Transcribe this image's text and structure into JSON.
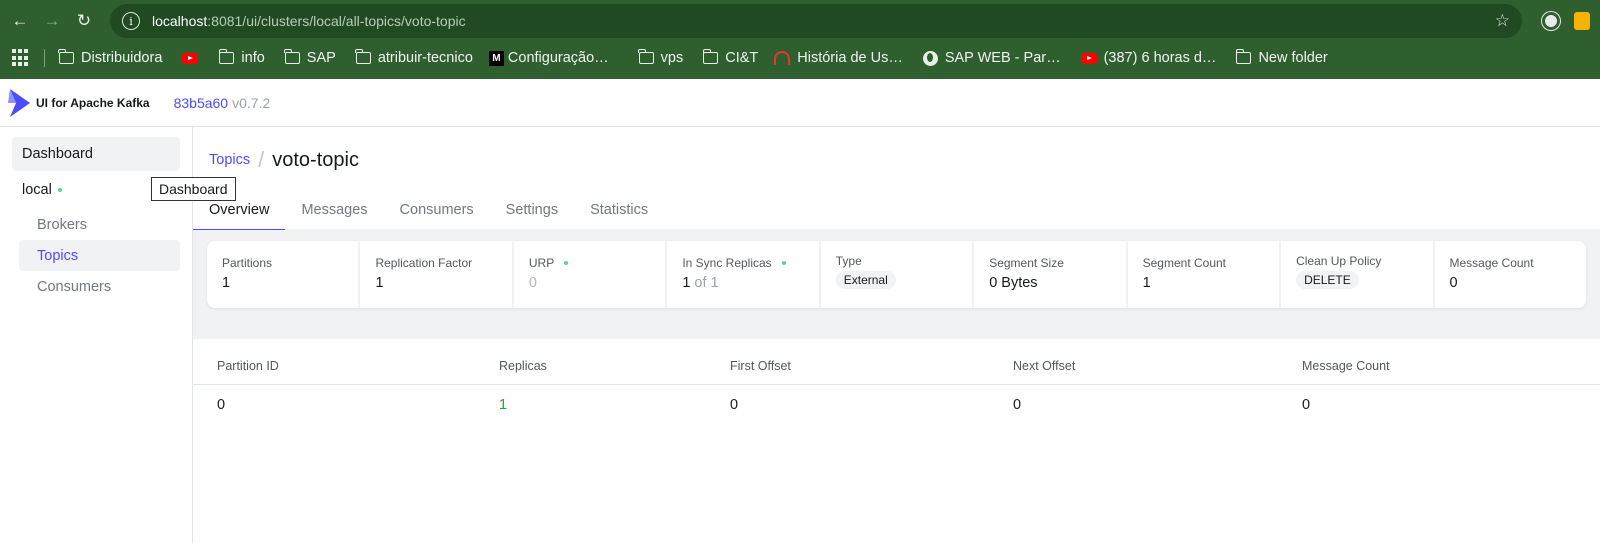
{
  "browser": {
    "url_host": "localhost",
    "url_rest": ":8081/ui/clusters/local/all-topics/voto-topic",
    "bookmarks": [
      {
        "label": "Distribuidora",
        "icon": "folder-icon"
      },
      {
        "label": "",
        "icon": "youtube-icon"
      },
      {
        "label": "info",
        "icon": "folder-icon"
      },
      {
        "label": "SAP",
        "icon": "folder-icon"
      },
      {
        "label": "atribuir-tecnico",
        "icon": "folder-icon"
      },
      {
        "label": "Configuração…",
        "icon": "medium-icon"
      },
      {
        "label": "vps",
        "icon": "folder-icon"
      },
      {
        "label": "CI&T",
        "icon": "folder-icon"
      },
      {
        "label": "História de Us…",
        "icon": "headset-icon"
      },
      {
        "label": "SAP WEB - Par…",
        "icon": "globe-icon"
      },
      {
        "label": "(387) 6 horas d…",
        "icon": "youtube-icon"
      },
      {
        "label": "New folder",
        "icon": "folder-icon"
      }
    ]
  },
  "header": {
    "brand": "UI for Apache Kafka",
    "commit": "83b5a60",
    "version": "v0.7.2"
  },
  "sidebar": {
    "dashboard": "Dashboard",
    "cluster": "local",
    "items": [
      "Brokers",
      "Topics",
      "Consumers"
    ],
    "tooltip": "Dashboard"
  },
  "breadcrumb": {
    "parent": "Topics",
    "separator": "/",
    "current": "voto-topic"
  },
  "tabs": [
    "Overview",
    "Messages",
    "Consumers",
    "Settings",
    "Statistics"
  ],
  "metrics": {
    "partitions": {
      "label": "Partitions",
      "value": "1"
    },
    "replication": {
      "label": "Replication Factor",
      "value": "1"
    },
    "urp": {
      "label": "URP",
      "value": "0"
    },
    "isr": {
      "label": "In Sync Replicas",
      "value": "1",
      "of": "of 1"
    },
    "type": {
      "label": "Type",
      "value": "External"
    },
    "segment_size": {
      "label": "Segment Size",
      "value": "0 Bytes"
    },
    "segment_count": {
      "label": "Segment Count",
      "value": "1"
    },
    "cleanup": {
      "label": "Clean Up Policy",
      "value": "DELETE"
    },
    "message_count": {
      "label": "Message Count",
      "value": "0"
    }
  },
  "table": {
    "headers": [
      "Partition ID",
      "Replicas",
      "First Offset",
      "Next Offset",
      "Message Count"
    ],
    "rows": [
      [
        "0",
        "1",
        "0",
        "0",
        "0"
      ]
    ]
  },
  "colors": {
    "accent": "#4c4cff",
    "chrome": "#2f5f2f",
    "status_green": "#5cd685",
    "replica_green": "#1da53b"
  }
}
